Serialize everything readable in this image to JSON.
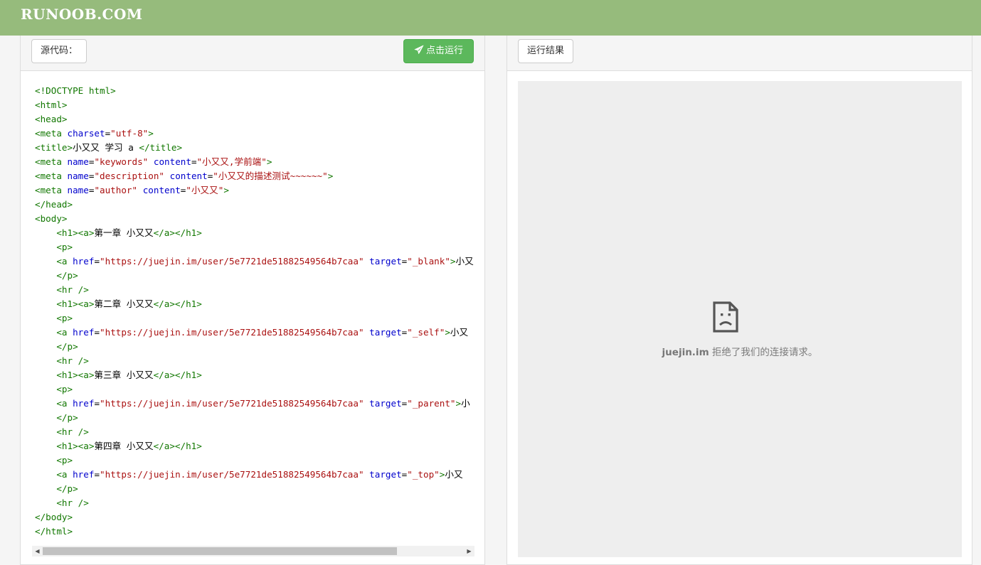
{
  "header": {
    "logo": "RUNOOB.COM"
  },
  "left_panel": {
    "source_label": "源代码：",
    "run_label": "点击运行",
    "code_lines": [
      [
        [
          "t",
          "<!DOCTYPE html>"
        ]
      ],
      [
        [
          "t",
          "<html>"
        ]
      ],
      [
        [
          "t",
          "<head>"
        ]
      ],
      [
        [
          "t",
          "<meta "
        ],
        [
          "a",
          "charset"
        ],
        [
          "p",
          "="
        ],
        [
          "s",
          "\"utf-8\""
        ],
        [
          "t",
          ">"
        ]
      ],
      [
        [
          "t",
          "<title>"
        ],
        [
          "p",
          "小又又 学习 a "
        ],
        [
          "t",
          "</title>"
        ]
      ],
      [
        [
          "t",
          "<meta "
        ],
        [
          "a",
          "name"
        ],
        [
          "p",
          "="
        ],
        [
          "s",
          "\"keywords\""
        ],
        [
          "p",
          " "
        ],
        [
          "a",
          "content"
        ],
        [
          "p",
          "="
        ],
        [
          "s",
          "\"小又又,学前端\""
        ],
        [
          "t",
          ">"
        ]
      ],
      [
        [
          "t",
          "<meta "
        ],
        [
          "a",
          "name"
        ],
        [
          "p",
          "="
        ],
        [
          "s",
          "\"description\""
        ],
        [
          "p",
          " "
        ],
        [
          "a",
          "content"
        ],
        [
          "p",
          "="
        ],
        [
          "s",
          "\"小又又的描述测试~~~~~~\""
        ],
        [
          "t",
          ">"
        ]
      ],
      [
        [
          "t",
          "<meta "
        ],
        [
          "a",
          "name"
        ],
        [
          "p",
          "="
        ],
        [
          "s",
          "\"author\""
        ],
        [
          "p",
          " "
        ],
        [
          "a",
          "content"
        ],
        [
          "p",
          "="
        ],
        [
          "s",
          "\"小又又\""
        ],
        [
          "t",
          ">"
        ]
      ],
      [
        [
          "t",
          "</head>"
        ]
      ],
      [
        [
          "t",
          "<body>"
        ]
      ],
      [
        [
          "p",
          "    "
        ],
        [
          "t",
          "<h1><a>"
        ],
        [
          "p",
          "第一章 小又又"
        ],
        [
          "t",
          "</a></h1>"
        ]
      ],
      [
        [
          "p",
          "    "
        ],
        [
          "t",
          "<p>"
        ]
      ],
      [
        [
          "p",
          "    "
        ],
        [
          "t",
          "<a "
        ],
        [
          "a",
          "href"
        ],
        [
          "p",
          "="
        ],
        [
          "s",
          "\"https://juejin.im/user/5e7721de51882549564b7caa\""
        ],
        [
          "p",
          " "
        ],
        [
          "a",
          "target"
        ],
        [
          "p",
          "="
        ],
        [
          "s",
          "\"_blank\""
        ],
        [
          "t",
          ">"
        ],
        [
          "p",
          "小又"
        ]
      ],
      [
        [
          "p",
          "    "
        ],
        [
          "t",
          "</p>"
        ]
      ],
      [
        [
          "p",
          "    "
        ],
        [
          "t",
          "<hr />"
        ]
      ],
      [
        [
          "p",
          "    "
        ],
        [
          "t",
          "<h1><a>"
        ],
        [
          "p",
          "第二章 小又又"
        ],
        [
          "t",
          "</a></h1>"
        ]
      ],
      [
        [
          "p",
          "    "
        ],
        [
          "t",
          "<p>"
        ]
      ],
      [
        [
          "p",
          "    "
        ],
        [
          "t",
          "<a "
        ],
        [
          "a",
          "href"
        ],
        [
          "p",
          "="
        ],
        [
          "s",
          "\"https://juejin.im/user/5e7721de51882549564b7caa\""
        ],
        [
          "p",
          " "
        ],
        [
          "a",
          "target"
        ],
        [
          "p",
          "="
        ],
        [
          "s",
          "\"_self\""
        ],
        [
          "t",
          ">"
        ],
        [
          "p",
          "小又"
        ]
      ],
      [
        [
          "p",
          "    "
        ],
        [
          "t",
          "</p>"
        ]
      ],
      [
        [
          "p",
          "    "
        ],
        [
          "t",
          "<hr />"
        ]
      ],
      [
        [
          "p",
          "    "
        ],
        [
          "t",
          "<h1><a>"
        ],
        [
          "p",
          "第三章 小又又"
        ],
        [
          "t",
          "</a></h1>"
        ]
      ],
      [
        [
          "p",
          "    "
        ],
        [
          "t",
          "<p>"
        ]
      ],
      [
        [
          "p",
          "    "
        ],
        [
          "t",
          "<a "
        ],
        [
          "a",
          "href"
        ],
        [
          "p",
          "="
        ],
        [
          "s",
          "\"https://juejin.im/user/5e7721de51882549564b7caa\""
        ],
        [
          "p",
          " "
        ],
        [
          "a",
          "target"
        ],
        [
          "p",
          "="
        ],
        [
          "s",
          "\"_parent\""
        ],
        [
          "t",
          ">"
        ],
        [
          "p",
          "小"
        ]
      ],
      [
        [
          "p",
          "    "
        ],
        [
          "t",
          "</p>"
        ]
      ],
      [
        [
          "p",
          "    "
        ],
        [
          "t",
          "<hr />"
        ]
      ],
      [
        [
          "p",
          "    "
        ],
        [
          "t",
          "<h1><a>"
        ],
        [
          "p",
          "第四章 小又又"
        ],
        [
          "t",
          "</a></h1>"
        ]
      ],
      [
        [
          "p",
          "    "
        ],
        [
          "t",
          "<p>"
        ]
      ],
      [
        [
          "p",
          "    "
        ],
        [
          "t",
          "<a "
        ],
        [
          "a",
          "href"
        ],
        [
          "p",
          "="
        ],
        [
          "s",
          "\"https://juejin.im/user/5e7721de51882549564b7caa\""
        ],
        [
          "p",
          " "
        ],
        [
          "a",
          "target"
        ],
        [
          "p",
          "="
        ],
        [
          "s",
          "\"_top\""
        ],
        [
          "t",
          ">"
        ],
        [
          "p",
          "小又"
        ]
      ],
      [
        [
          "p",
          "    "
        ],
        [
          "t",
          "</p>"
        ]
      ],
      [
        [
          "p",
          "    "
        ],
        [
          "t",
          "<hr />"
        ]
      ],
      [
        [
          "t",
          "</body>"
        ]
      ],
      [
        [
          "t",
          "</html>"
        ]
      ]
    ]
  },
  "right_panel": {
    "result_label": "运行结果",
    "error": {
      "host": "juejin.im",
      "message": " 拒绝了我们的连接请求。"
    }
  },
  "icons": {
    "run": "send-icon",
    "error": "sad-page-icon"
  },
  "colors": {
    "header": "#96bb7c",
    "run_button": "#5cb85c",
    "tag": "#117700",
    "attr": "#0000cc",
    "string": "#aa1111"
  }
}
